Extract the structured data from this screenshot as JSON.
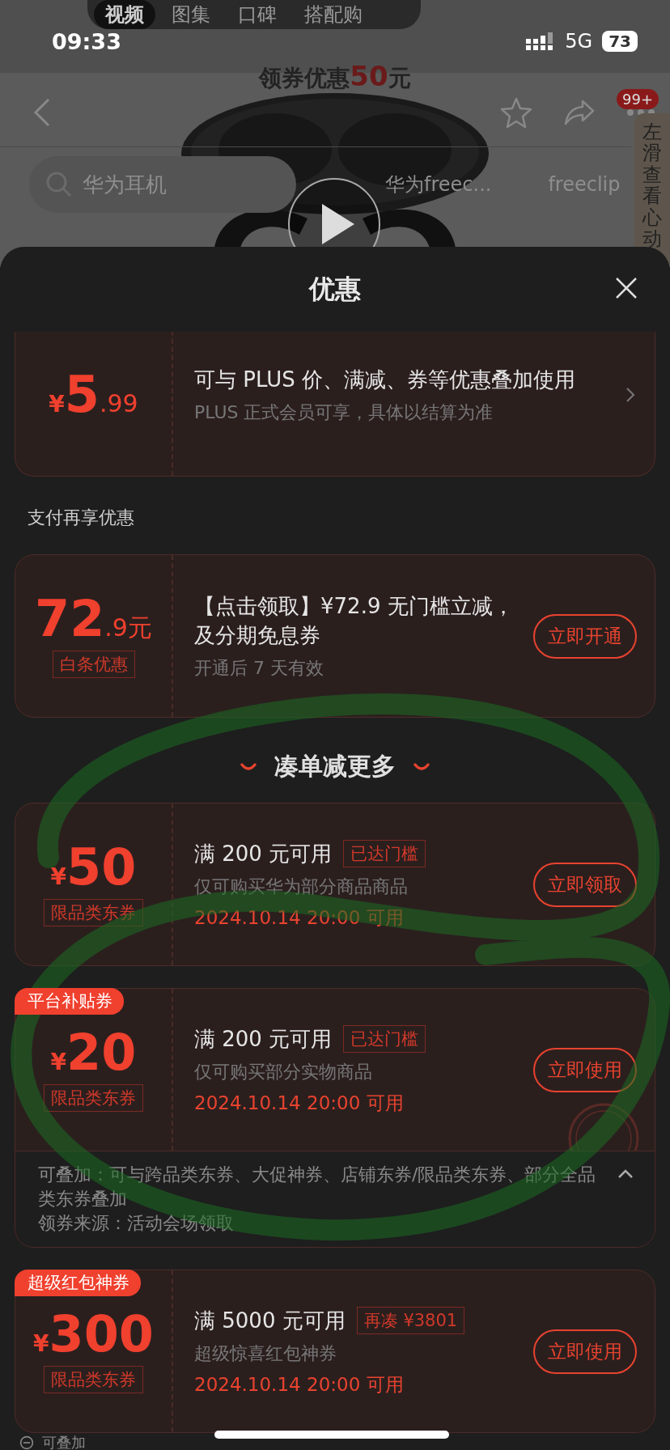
{
  "page_tabs": [
    {
      "label": "视频",
      "selected": true
    },
    {
      "label": "图集",
      "selected": false
    },
    {
      "label": "口碑",
      "selected": false
    },
    {
      "label": "搭配购",
      "selected": false
    }
  ],
  "status_bar": {
    "time": "09:33",
    "network": "5G",
    "battery": "73"
  },
  "banner": {
    "text": "领券优惠",
    "amount": "50",
    "unit": "元"
  },
  "notification_badge": "99+",
  "search": {
    "placeholder": "华为耳机",
    "suggestions": [
      "华为freec...",
      "freeclip"
    ]
  },
  "side_tab": "左滑查看心动",
  "sheet": {
    "title": "优惠"
  },
  "sections": [
    {
      "kind": "coupon",
      "price": {
        "symbol": "¥",
        "whole": "5",
        "fraction": ".99"
      },
      "title": "可与 PLUS 价、满减、券等优惠叠加使用",
      "desc": "PLUS 正式会员可享，具体以结算为准",
      "action": {
        "kind": "chevron"
      }
    },
    {
      "kind": "label",
      "text": "支付再享优惠"
    },
    {
      "kind": "coupon",
      "price": {
        "whole": "72",
        "fraction": ".9元"
      },
      "tag": "白条优惠",
      "title": "【点击领取】¥72.9 无门槛立减，及分期免息券",
      "desc": "开通后 7 天有效",
      "action": {
        "kind": "button",
        "label": "立即开通"
      }
    },
    {
      "kind": "heading",
      "text": "凑单减更多"
    },
    {
      "kind": "coupon",
      "price": {
        "symbol": "¥",
        "whole": "50"
      },
      "tag": "限品类东券",
      "title": "满 200 元可用",
      "title_tag": "已达门槛",
      "desc": "仅可购买华为部分商品商品",
      "date": "2024.10.14 20:00 可用",
      "action": {
        "kind": "button",
        "label": "立即领取"
      }
    },
    {
      "kind": "coupon",
      "ribbon": "平台补贴券",
      "price": {
        "symbol": "¥",
        "whole": "20"
      },
      "tag": "限品类东券",
      "title": "满 200 元可用",
      "title_tag": "已达门槛",
      "desc": "仅可购买部分实物商品",
      "date": "2024.10.14 20:00 可用",
      "action": {
        "kind": "button",
        "label": "立即使用"
      },
      "stamped": true,
      "expanded": true,
      "details": [
        "可叠加：可与跨品类东券、大促神券、店铺东券/限品类东券、部分全品类东券叠加",
        "领券来源：活动会场领取"
      ]
    },
    {
      "kind": "coupon",
      "ribbon": "超级红包神券",
      "price": {
        "symbol": "¥",
        "whole": "300"
      },
      "tag": "限品类东券",
      "title": "满 5000 元可用",
      "title_tag": "再凑 ¥3801",
      "desc": "超级惊喜红包神券",
      "date": "2024.10.14 20:00 可用",
      "action": {
        "kind": "button",
        "label": "立即使用"
      }
    }
  ],
  "footer_note": "可叠加"
}
